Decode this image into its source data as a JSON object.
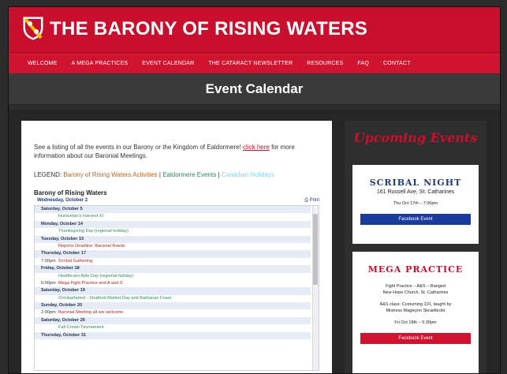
{
  "header": {
    "site_title": "THE BARONY OF RISING WATERS",
    "colors": {
      "brand_red": "#c8102e",
      "nav_red": "#d0142f",
      "dark": "#2e2e2e"
    }
  },
  "nav": {
    "items": [
      "WELCOME",
      "A MEGA PRACTICES",
      "EVENT CALENDAR",
      "THE CATARACT NEWSLETTER",
      "RESOURCES",
      "FAQ",
      "CONTACT"
    ]
  },
  "page": {
    "title": "Event Calendar"
  },
  "main": {
    "intro_text": "See a listing of all the events in our Barony or the Kingdom of Ealdormere!",
    "intro_link": "click here",
    "intro_text2": "for more information about our Baronial Meetings.",
    "legend_label": "LEGEND:",
    "legend_a": "Barony of Rising Waters Activities",
    "legend_sep1": "|",
    "legend_b": "Ealdormere Events",
    "legend_sep2": "|",
    "legend_c": "Canadian Holidays",
    "calendar_name": "Barony of Rising Waters",
    "calendar_current": "Wednesday, October 2",
    "print_label": "Print",
    "rows": [
      {
        "type": "day",
        "text": "Saturday, October 5"
      },
      {
        "type": "ev",
        "time": "",
        "text": "Huntsman's Harvest XI",
        "color": "green"
      },
      {
        "type": "day",
        "text": "Monday, October 14"
      },
      {
        "type": "ev",
        "time": "",
        "text": "Thanksgiving Day (regional holiday)",
        "color": "green"
      },
      {
        "type": "day",
        "text": "Tuesday, October 15"
      },
      {
        "type": "ev",
        "time": "",
        "text": "Reports Deadline: Baronial Reeds",
        "color": "red"
      },
      {
        "type": "day",
        "text": "Thursday, October 17"
      },
      {
        "type": "ev",
        "time": "7:00pm",
        "text": "Scribal Gathering",
        "color": "red"
      },
      {
        "type": "day",
        "text": "Friday, October 18"
      },
      {
        "type": "ev",
        "time": "",
        "text": "Healthcare Aide Day (regional holiday)",
        "color": "green"
      },
      {
        "type": "ev",
        "time": "6:00pm",
        "text": "Mega Fight Practice and A and S",
        "color": "red"
      },
      {
        "type": "day",
        "text": "Saturday, October 19"
      },
      {
        "type": "ev",
        "time": "",
        "text": "Octobarfarted - Stratford Market Day and Barbarian Feast",
        "color": "green"
      },
      {
        "type": "day",
        "text": "Sunday, October 20"
      },
      {
        "type": "ev",
        "time": "2:00pm",
        "text": "Baronial Meeting all are welcome",
        "color": "red"
      },
      {
        "type": "day",
        "text": "Saturday, October 26"
      },
      {
        "type": "ev",
        "time": "",
        "text": "Fall Crown Tournament",
        "color": "green"
      },
      {
        "type": "day",
        "text": "Thursday, October 31"
      }
    ]
  },
  "sidebar": {
    "heading": "Upcoming Events",
    "card1": {
      "title": "SCRIBAL NIGHT",
      "location": "161 Russell Ave, St. Catharines",
      "date": "Thu Oct 17th – 7:00pm",
      "button": "Facebook Event"
    },
    "card2": {
      "title": "MEGA PRACTICE",
      "line1": "Fight Practice – A&S – Ranged",
      "line2": "New Hope Church, St. Catharines",
      "line3": "A&S class: Costuming 101, taught by",
      "line4": "Mistress Magwynn Skraelbrokt",
      "date": "Fri Oct 18th – 5:30pm",
      "button": "Facebook Event"
    }
  }
}
